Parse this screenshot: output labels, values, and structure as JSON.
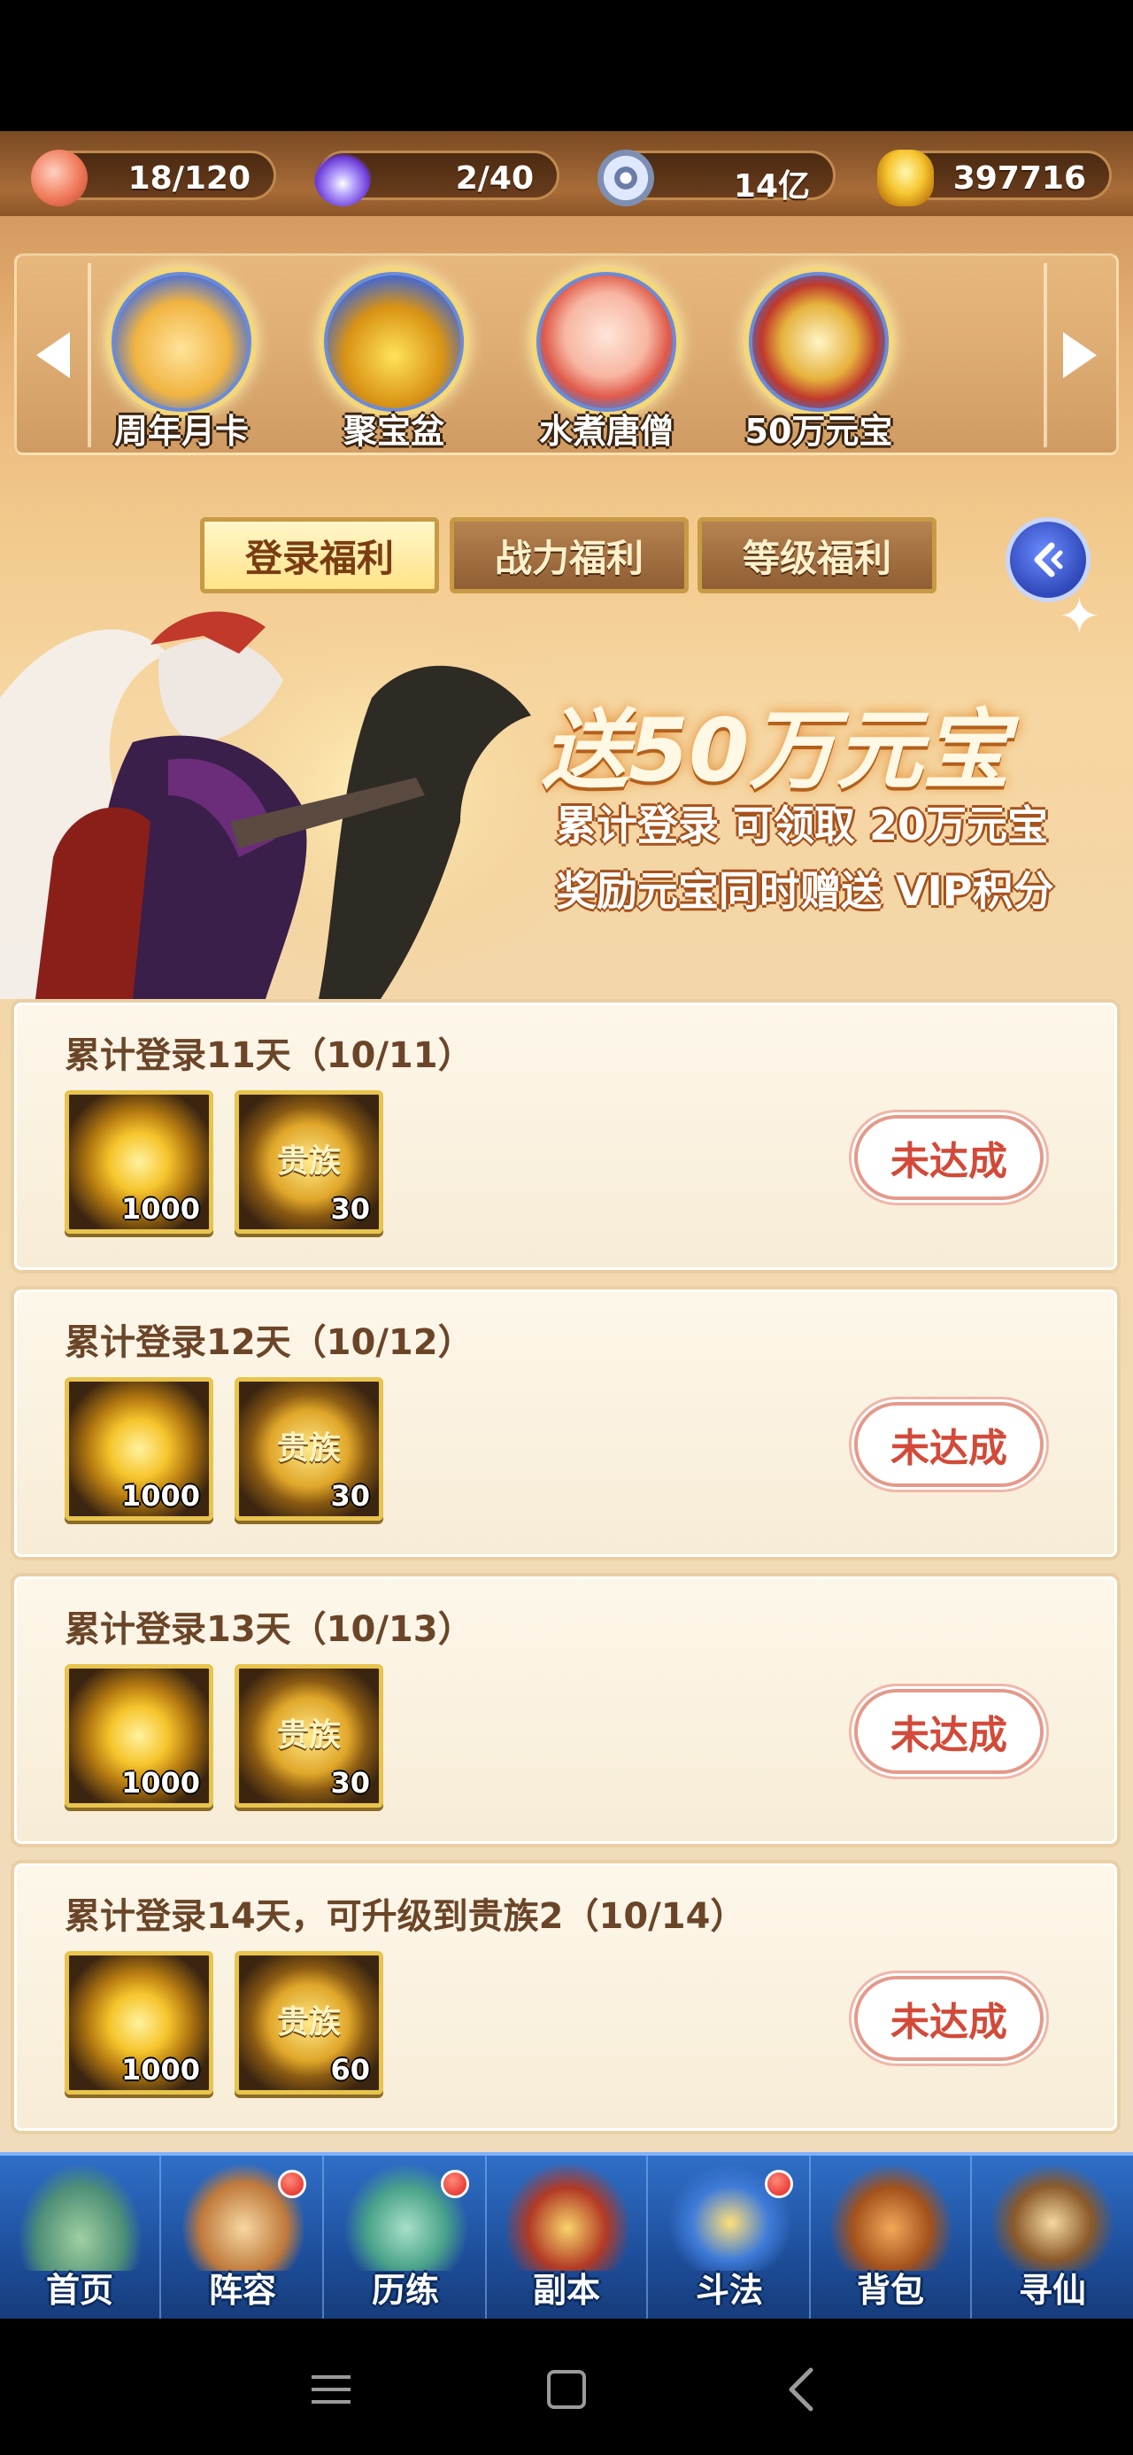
{
  "resources": [
    {
      "icon": "peach-icon",
      "value": "18/120"
    },
    {
      "icon": "spirit-flame-icon",
      "value": "2/40"
    },
    {
      "icon": "copper-coin-icon",
      "value": "14亿"
    },
    {
      "icon": "gold-ingot-icon",
      "value": "397716"
    }
  ],
  "carousel": {
    "items": [
      {
        "label": "周年月卡",
        "icon": "anniversary-card-icon"
      },
      {
        "label": "聚宝盆",
        "icon": "treasure-bowl-icon"
      },
      {
        "label": "水煮唐僧",
        "icon": "monk-icon"
      },
      {
        "label": "50万元宝",
        "icon": "treasure-chest-icon"
      }
    ]
  },
  "tabs": [
    {
      "label": "登录福利",
      "active": true
    },
    {
      "label": "战力福利",
      "active": false
    },
    {
      "label": "等级福利",
      "active": false
    }
  ],
  "banner": {
    "title": "送50万元宝",
    "line1": "累计登录 可领取 20万元宝",
    "line2": "奖励元宝同时赠送 VIP积分"
  },
  "rewards": [
    {
      "title": "累计登录11天（10/11）",
      "gold_qty": "1000",
      "vip_label": "贵族",
      "vip_qty": "30",
      "status": "未达成"
    },
    {
      "title": "累计登录12天（10/12）",
      "gold_qty": "1000",
      "vip_label": "贵族",
      "vip_qty": "30",
      "status": "未达成"
    },
    {
      "title": "累计登录13天（10/13）",
      "gold_qty": "1000",
      "vip_label": "贵族",
      "vip_qty": "30",
      "status": "未达成"
    },
    {
      "title": "累计登录14天，可升级到贵族2（10/14）",
      "gold_qty": "1000",
      "vip_label": "贵族",
      "vip_qty": "60",
      "status": "未达成"
    }
  ],
  "nav": [
    {
      "label": "首页",
      "badge": false
    },
    {
      "label": "阵容",
      "badge": true
    },
    {
      "label": "历练",
      "badge": true
    },
    {
      "label": "副本",
      "badge": false
    },
    {
      "label": "斗法",
      "badge": true
    },
    {
      "label": "背包",
      "badge": false
    },
    {
      "label": "寻仙",
      "badge": false
    }
  ],
  "colors": {
    "accent_gold": "#e8c44d",
    "status_red": "#d24a39",
    "nav_blue": "#1e4f9c"
  }
}
